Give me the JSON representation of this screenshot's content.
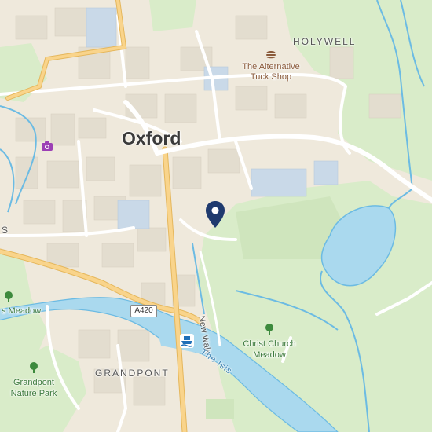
{
  "map": {
    "city_label": "Oxford",
    "district_labels": {
      "holywell": "HOLYWELL",
      "grandpont": "GRANDPONT",
      "edge_left": "S"
    },
    "poi_labels": {
      "alternative_tuck_shop": "The Alternative Tuck Shop",
      "christ_church_meadow": "Christ Church Meadow",
      "grandpont_nature_park": "Grandpont Nature Park",
      "meadow_edge": "s Meadow"
    },
    "road_labels": {
      "a420": "A420",
      "new_walk": "New Walk",
      "the_isis": "The Isis"
    },
    "icons": {
      "marker": "location-pin-icon",
      "tuck_shop": "burger-food-icon",
      "camera": "camera-icon",
      "boat": "boat-icon",
      "trees": "tree-icon"
    },
    "colors": {
      "urban": "#efe9dc",
      "buildings": "#e2dcce",
      "park": "#d8ecc8",
      "water": "#a6d8ef",
      "river_stroke": "#5bb0e0",
      "primary_road": "#f9d48b",
      "marker": "#1f3a6e"
    }
  }
}
